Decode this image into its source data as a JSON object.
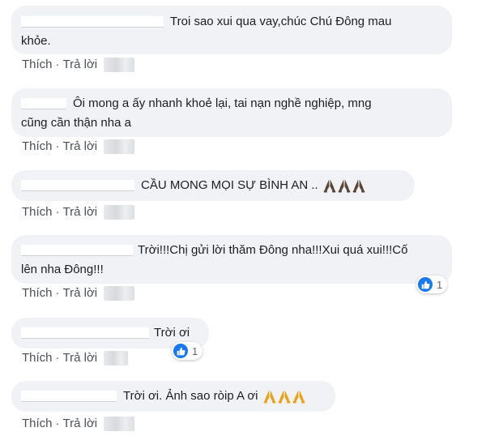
{
  "comments": [
    {
      "line1": "Troi sao xui qua vay,chúc Chú Đông mau",
      "line2": "khỏe."
    },
    {
      "line1": "Ôi mong a ấy nhanh khoẻ lại, tai nạn nghề nghiệp, mng",
      "line2": "cũng cần thận nha a"
    },
    {
      "line1": "CẦU MONG MỌI SỰ BÌNH AN .."
    },
    {
      "line1": "Trời!!!Chị gửi lời thăm Đông nha!!!Xui quá xui!!!Cố",
      "line2": "lên nha Đông!!!",
      "reactions": "1"
    },
    {
      "line1": "Trời ơi",
      "reactions": "1"
    },
    {
      "line1": "Trời ơi. Ảnh sao ròip A ơi"
    }
  ],
  "actions": {
    "like": "Thích",
    "reply": "Trả lời",
    "separator": "·"
  },
  "icons": {
    "reaction": "like-icon",
    "emoji": "folded-hands-icon"
  },
  "colors": {
    "bubble": "#f0f2f5",
    "like_blue": "#1877f2",
    "emoji_dark": "#5b4636",
    "emoji_gold": "#e8a317"
  }
}
